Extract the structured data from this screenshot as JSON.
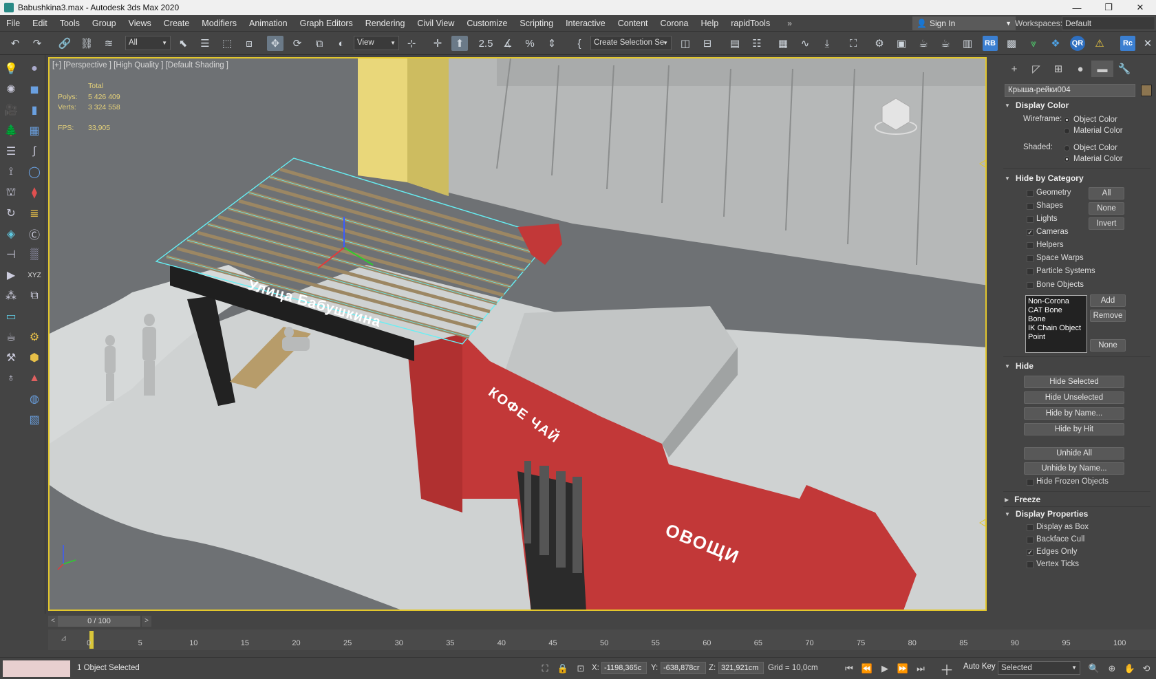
{
  "window": {
    "title": "Babushkina3.max - Autodesk 3ds Max 2020",
    "controls": [
      "—",
      "❐",
      "✕"
    ]
  },
  "menubar": {
    "items": [
      "File",
      "Edit",
      "Tools",
      "Group",
      "Views",
      "Create",
      "Modifiers",
      "Animation",
      "Graph Editors",
      "Rendering",
      "Civil View",
      "Customize",
      "Scripting",
      "Interactive",
      "Content",
      "Corona",
      "Help",
      "rapidTools"
    ],
    "more": "»",
    "sign_in": "Sign In",
    "workspaces_label": "Workspaces:",
    "workspaces_value": "Default"
  },
  "toolbar": {
    "selection_filter": "All",
    "ref_coord": "View",
    "named_selection": "Create Selection Se",
    "rb_label": "RB",
    "qr_label": "QR",
    "rc_label": "Rc"
  },
  "viewport": {
    "label": "[+] [Perspective ] [High Quality ] [Default Shading ]",
    "stats": {
      "total_label": "Total",
      "polys_label": "Polys:",
      "polys_value": "5 426 409",
      "verts_label": "Verts:",
      "verts_value": "3 324 558",
      "fps_label": "FPS:",
      "fps_value": "33,905"
    },
    "scene_text": {
      "street_sign": "Улица Бабушкина",
      "cafe_sign": "КОФЕ ЧАЙ",
      "veg_sign": "ОВОЩИ"
    },
    "colors": {
      "selection": "#66f0f5",
      "building_red": "#c23838",
      "ground": "#d9dcdc",
      "asphalt": "#6d7073"
    }
  },
  "command_panel": {
    "object_name": "Крыша-рейки004",
    "display_color": {
      "title": "Display Color",
      "wireframe_label": "Wireframe:",
      "shaded_label": "Shaded:",
      "object_color": "Object Color",
      "material_color": "Material Color"
    },
    "hide_by_category": {
      "title": "Hide by Category",
      "items": [
        {
          "label": "Geometry",
          "checked": false
        },
        {
          "label": "Shapes",
          "checked": false
        },
        {
          "label": "Lights",
          "checked": false
        },
        {
          "label": "Cameras",
          "checked": true
        },
        {
          "label": "Helpers",
          "checked": false
        },
        {
          "label": "Space Warps",
          "checked": false
        },
        {
          "label": "Particle Systems",
          "checked": false
        },
        {
          "label": "Bone Objects",
          "checked": false
        }
      ],
      "buttons": {
        "all": "All",
        "none": "None",
        "invert": "Invert"
      },
      "list": [
        "Non-Corona",
        "CAT Bone",
        "Bone",
        "IK Chain Object",
        "Point"
      ],
      "list_buttons": {
        "add": "Add",
        "remove": "Remove",
        "none": "None"
      }
    },
    "hide": {
      "title": "Hide",
      "buttons": [
        "Hide Selected",
        "Hide Unselected",
        "Hide by Name...",
        "Hide by Hit",
        "Unhide All",
        "Unhide by Name..."
      ],
      "hide_frozen": "Hide Frozen Objects"
    },
    "freeze": {
      "title": "Freeze"
    },
    "display_properties": {
      "title": "Display Properties",
      "items": [
        {
          "label": "Display as Box",
          "checked": false
        },
        {
          "label": "Backface Cull",
          "checked": false
        },
        {
          "label": "Edges Only",
          "checked": true
        },
        {
          "label": "Vertex Ticks",
          "checked": false
        }
      ]
    }
  },
  "timeline": {
    "frame_display": "0 / 100",
    "ticks": [
      "0",
      "5",
      "10",
      "15",
      "20",
      "25",
      "30",
      "35",
      "40",
      "45",
      "50",
      "55",
      "60",
      "65",
      "70",
      "75",
      "80",
      "85",
      "90",
      "95",
      "100"
    ]
  },
  "statusbar": {
    "status": "1 Object Selected",
    "x_label": "X:",
    "x_value": "-1198,365c",
    "y_label": "Y:",
    "y_value": "-638,878cr",
    "z_label": "Z:",
    "z_value": "321,921cm",
    "grid": "Grid = 10,0cm",
    "auto_key": "Auto Key",
    "key_filter": "Selected"
  }
}
